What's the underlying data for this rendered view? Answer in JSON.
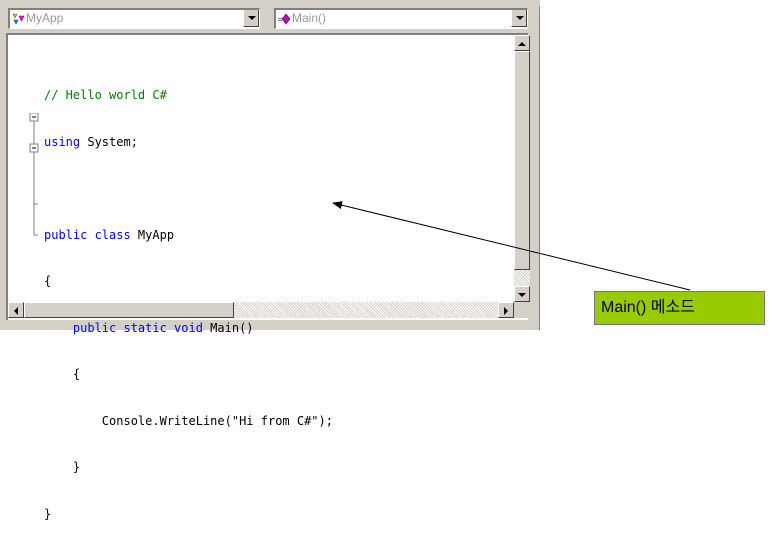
{
  "class_dropdown": {
    "value": "MyApp",
    "icon": "class-members-icon"
  },
  "member_dropdown": {
    "value": "Main()",
    "icon": "method-icon"
  },
  "code": {
    "line1": "// Hello world C#",
    "line2_kw": "using",
    "line2_rest": " System;",
    "line4_kw": "public class",
    "line4_rest": " MyApp",
    "line5": "{",
    "line6_kw": "public static void",
    "line6_rest": " Main()",
    "line7": "{",
    "line8": "Console.WriteLine(\"Hi from C#\");",
    "line9": "}",
    "line10": "}"
  },
  "callout": {
    "label": "Main() 메소드",
    "color": "#99cc00"
  },
  "colors": {
    "keyword": "#0000ff",
    "comment": "#008000"
  }
}
